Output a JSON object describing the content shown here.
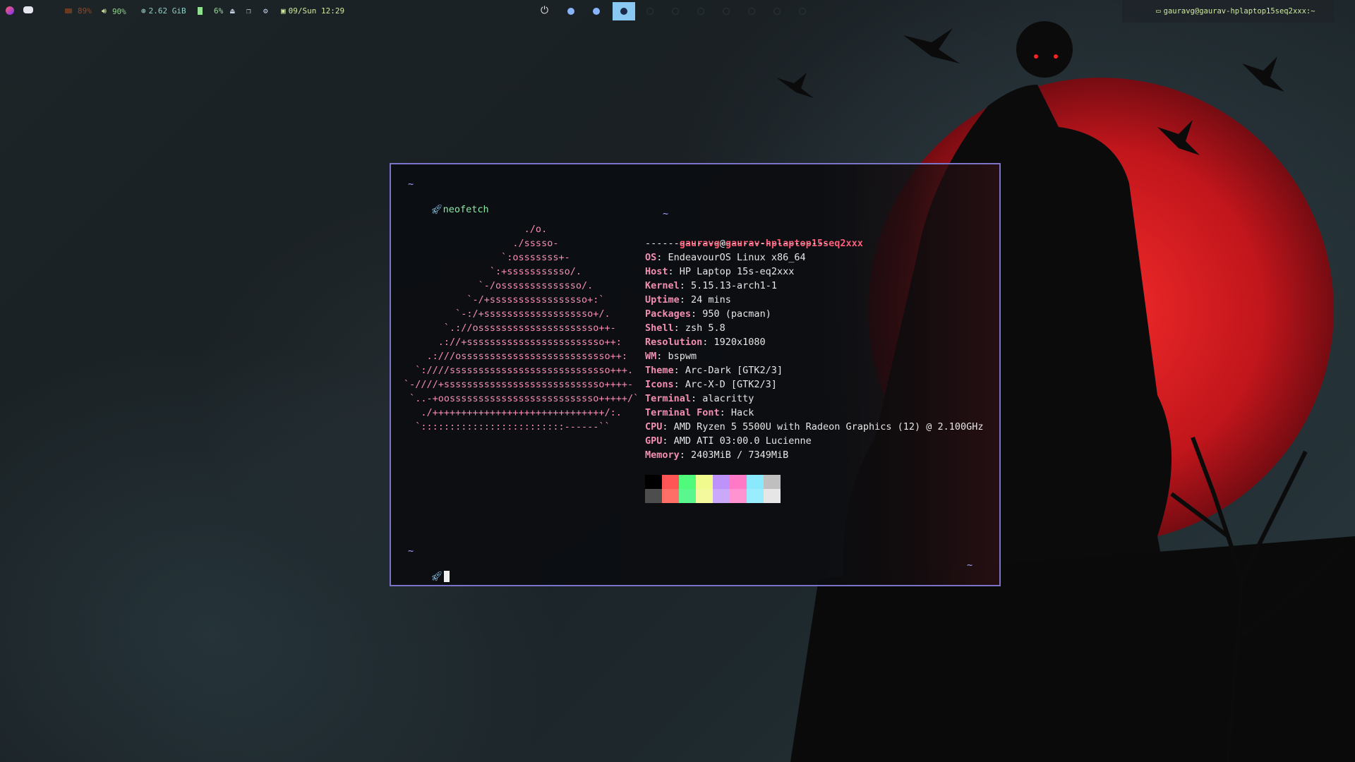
{
  "topbar": {
    "cpu_label": "89%",
    "volume_label": "90%",
    "ram_label": "2.62 GiB",
    "battery_label": "6%",
    "date_label": "09/Sun 12:29",
    "window_title": "gauravg@gaurav-hplaptop15seq2xxx:~"
  },
  "terminal": {
    "tilde_top": "~",
    "command": "neofetch",
    "info_tilde": "~",
    "user": "gauravg",
    "at": "@",
    "host": "gaurav-hplaptop15seq2xxx",
    "separator": "--------------------------------",
    "info": [
      {
        "key": "OS",
        "value": ": EndeavourOS Linux x86_64"
      },
      {
        "key": "Host",
        "value": ": HP Laptop 15s-eq2xxx"
      },
      {
        "key": "Kernel",
        "value": ": 5.15.13-arch1-1"
      },
      {
        "key": "Uptime",
        "value": ": 24 mins"
      },
      {
        "key": "Packages",
        "value": ": 950 (pacman)"
      },
      {
        "key": "Shell",
        "value": ": zsh 5.8"
      },
      {
        "key": "Resolution",
        "value": ": 1920x1080"
      },
      {
        "key": "WM",
        "value": ": bspwm"
      },
      {
        "key": "Theme",
        "value": ": Arc-Dark [GTK2/3]"
      },
      {
        "key": "Icons",
        "value": ": Arc-X-D [GTK2/3]"
      },
      {
        "key": "Terminal",
        "value": ": alacritty"
      },
      {
        "key": "Terminal Font",
        "value": ": Hack"
      },
      {
        "key": "CPU",
        "value": ": AMD Ryzen 5 5500U with Radeon Graphics (12) @ 2.100GHz"
      },
      {
        "key": "GPU",
        "value": ": AMD ATI 03:00.0 Lucienne"
      },
      {
        "key": "Memory",
        "value": ": 2403MiB / 7349MiB"
      }
    ],
    "ascii": [
      "                     ./o.",
      "                   ./sssso-",
      "                 `:osssssss+-",
      "               `:+sssssssssso/.",
      "             `-/ossssssssssssso/.",
      "           `-/+sssssssssssssssso+:`",
      "         `-:/+sssssssssssssssssso+/.",
      "       `.://osssssssssssssssssssso++-",
      "      .://+ssssssssssssssssssssssso++:",
      "    .:///ossssssssssssssssssssssssso++:",
      "  `:////ssssssssssssssssssssssssssso+++.",
      "`-////+ssssssssssssssssssssssssssso++++-",
      " `..-+oossssssssssssssssssssssssso+++++/`",
      "   ./++++++++++++++++++++++++++++++/:.",
      "  `:::::::::::::::::::::::::------``"
    ],
    "palette_top": [
      "#000000",
      "#ff5555",
      "#50fa7b",
      "#f1fa8c",
      "#bd93f9",
      "#ff79c6",
      "#8be9fd",
      "#bfbfbf"
    ],
    "palette_bottom": [
      "#4d4d4d",
      "#ff6e67",
      "#5af78e",
      "#f4f99d",
      "#caa9fa",
      "#ff92d0",
      "#9aedfe",
      "#e6e6e6"
    ],
    "prompt_tilde": "~",
    "right_tilde": "~"
  }
}
